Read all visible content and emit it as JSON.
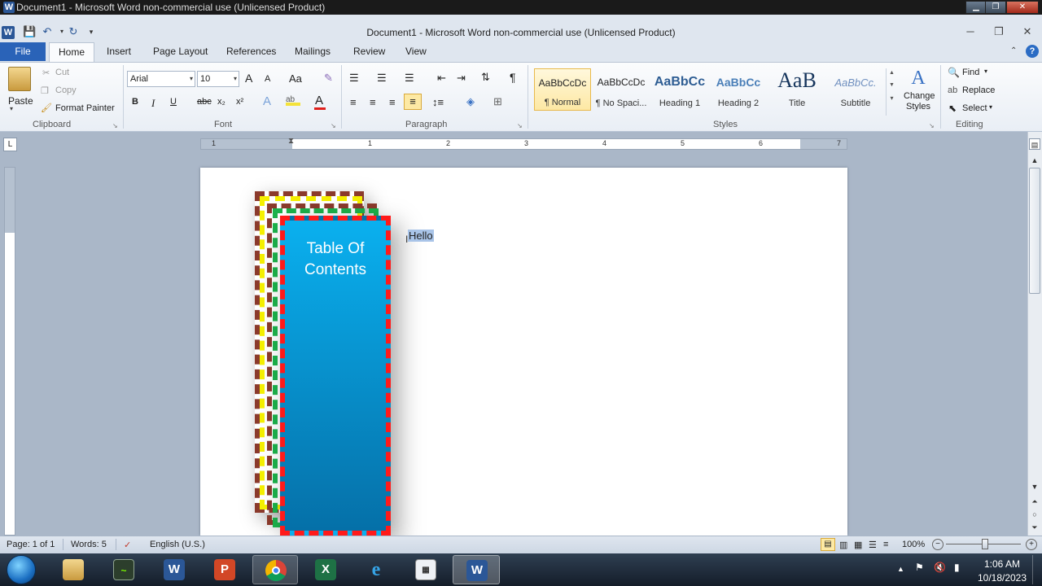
{
  "os_window": {
    "title": "Document1 - Microsoft Word non-commercial use (Unlicensed Product)",
    "app_letter": "W"
  },
  "word": {
    "title": "Document1  -  Microsoft Word non-commercial use (Unlicensed Product)"
  },
  "tabs": [
    "File",
    "Home",
    "Insert",
    "Page Layout",
    "References",
    "Mailings",
    "Review",
    "View"
  ],
  "clipboard": {
    "paste": "Paste",
    "cut": "Cut",
    "copy": "Copy",
    "format_painter": "Format Painter",
    "label": "Clipboard"
  },
  "font": {
    "name": "Arial",
    "size": "10",
    "label": "Font",
    "bold": "B",
    "italic": "I",
    "underline": "U",
    "strike": "abc",
    "subscript": "x₂",
    "superscript": "x²",
    "grow": "A",
    "shrink": "A",
    "case": "Aa",
    "color_a": "A"
  },
  "paragraph": {
    "label": "Paragraph",
    "pilcrow": "¶"
  },
  "styles": {
    "label": "Styles",
    "items": [
      {
        "sample": "AaBbCcDc",
        "name": "¶ Normal"
      },
      {
        "sample": "AaBbCcDc",
        "name": "¶ No Spaci..."
      },
      {
        "sample": "AaBbCc",
        "name": "Heading 1"
      },
      {
        "sample": "AaBbCc",
        "name": "Heading 2"
      },
      {
        "sample": "AaB",
        "name": "Title"
      },
      {
        "sample": "AaBbCc.",
        "name": "Subtitle"
      }
    ],
    "change_styles_line1": "Change",
    "change_styles_line2": "Styles"
  },
  "editing": {
    "label": "Editing",
    "find": "Find",
    "replace": "Replace",
    "select": "Select"
  },
  "ruler": {
    "numbers": [
      "1",
      "1",
      "2",
      "3",
      "4",
      "5",
      "6",
      "7"
    ]
  },
  "document": {
    "shape_text_line1": "Table Of",
    "shape_text_line2": "Contents",
    "body_text": "Hello"
  },
  "status": {
    "page": "Page: 1 of 1",
    "words": "Words: 5",
    "language": "English (U.S.)",
    "zoom": "100%"
  },
  "clock": {
    "time": "1:06 AM",
    "date": "10/18/2023"
  },
  "colors": {
    "file_tab": "#2a63b8",
    "highlight": "#f4e23a",
    "font_color": "#e0201b",
    "shape_blue": "#0aa3e0",
    "dash_red": "#ff1a1a",
    "dash_green": "#1db34c",
    "dash_yellow": "#f5f000",
    "dash_brown": "#8b3a2c"
  }
}
